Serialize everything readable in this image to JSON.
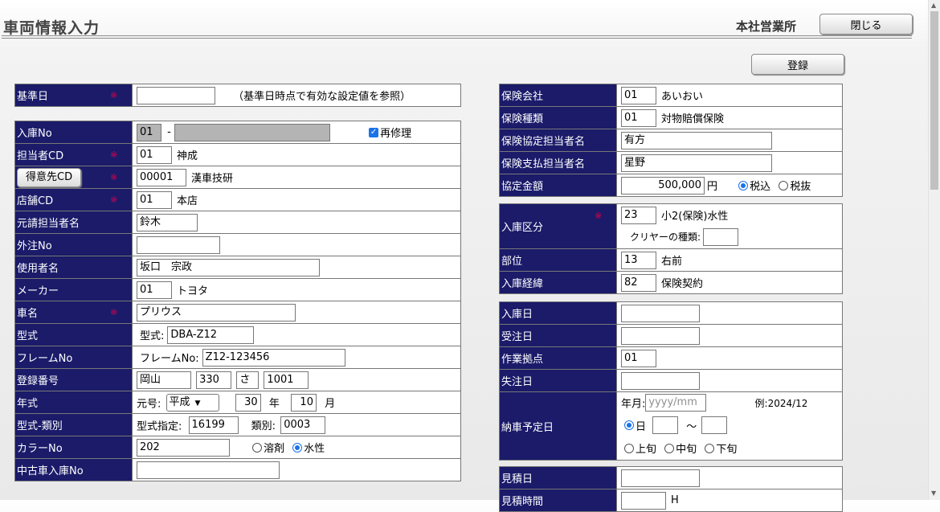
{
  "header": {
    "title": "車両情報入力",
    "office": "本社営業所",
    "close_label": "閉じる"
  },
  "register_label": "登録",
  "required_mark": "※",
  "base": {
    "label": "基準日",
    "value": "",
    "note": "（基準日時点で有効な設定値を参照）"
  },
  "left": {
    "nyuko_no": {
      "label": "入庫No",
      "prefix": "01",
      "dash": "-",
      "number": "",
      "repair_label": "再修理",
      "repair_checked": true,
      "check_glyph": "✓"
    },
    "tanto": {
      "label": "担当者CD",
      "code": "01",
      "name": "神成"
    },
    "tokui": {
      "button": "得意先CD",
      "code": "00001",
      "name": "漢車技研"
    },
    "tenpo": {
      "label": "店舗CD",
      "code": "01",
      "name": "本店"
    },
    "moto": {
      "label": "元請担当者名",
      "value": "鈴木"
    },
    "gaichu": {
      "label": "外注No",
      "value": ""
    },
    "user": {
      "label": "使用者名",
      "value": "坂口　宗政"
    },
    "maker": {
      "label": "メーカー",
      "code": "01",
      "name": "トヨタ"
    },
    "car": {
      "label": "車名",
      "value": "プリウス"
    },
    "model": {
      "label": "型式",
      "prefix": "型式:",
      "value": "DBA-Z12"
    },
    "frame": {
      "label": "フレームNo",
      "prefix": "フレームNo:",
      "value": "Z12-123456"
    },
    "reg": {
      "label": "登録番号",
      "area": "岡山",
      "cls": "330",
      "kana": "さ",
      "num": "1001"
    },
    "year": {
      "label": "年式",
      "era_label": "元号:",
      "era": "平成",
      "year": "30",
      "year_unit": "年",
      "month": "10",
      "month_unit": "月",
      "arrow": "▼"
    },
    "kind": {
      "label": "型式-類別",
      "spec_label": "型式指定:",
      "spec": "16199",
      "class_label": "類別:",
      "class_value": "0003"
    },
    "color": {
      "label": "カラーNo",
      "value": "202",
      "opt1": "溶剤",
      "opt2": "水性",
      "selected": "水性"
    },
    "used": {
      "label": "中古車入庫No",
      "value": ""
    }
  },
  "right": {
    "ins_company": {
      "label": "保険会社",
      "code": "01",
      "name": "あいおい"
    },
    "ins_type": {
      "label": "保険種類",
      "code": "01",
      "name": "対物賠償保険"
    },
    "ins_agree": {
      "label": "保険協定担当者名",
      "value": "有方"
    },
    "ins_pay": {
      "label": "保険支払担当者名",
      "value": "星野"
    },
    "amount": {
      "label": "協定金額",
      "value": "500,000",
      "unit": "円",
      "opt1": "税込",
      "opt2": "税抜",
      "selected": "税込"
    },
    "nyuko_kbn": {
      "label": "入庫区分",
      "code": "23",
      "name": "小2(保険)水性",
      "clear_label": "クリヤーの種類:",
      "clear_value": ""
    },
    "part": {
      "label": "部位",
      "code": "13",
      "name": "右前"
    },
    "history": {
      "label": "入庫経緯",
      "code": "82",
      "name": "保険契約"
    },
    "nyuko_date": {
      "label": "入庫日",
      "value": ""
    },
    "order_date": {
      "label": "受注日",
      "value": ""
    },
    "base_site": {
      "label": "作業拠点",
      "value": "01"
    },
    "lost_date": {
      "label": "失注日",
      "value": ""
    },
    "delivery": {
      "label": "納車予定日",
      "ym_label": "年月:",
      "ym_placeholder": "yyyy/mm",
      "example": "例:2024/12",
      "day_label": "日",
      "tilde": "～",
      "early": "上旬",
      "mid": "中旬",
      "late": "下旬",
      "selected": "日"
    },
    "estimate_date": {
      "label": "見積日",
      "value": ""
    },
    "estimate_time": {
      "label": "見積時間",
      "unit": "H"
    }
  }
}
